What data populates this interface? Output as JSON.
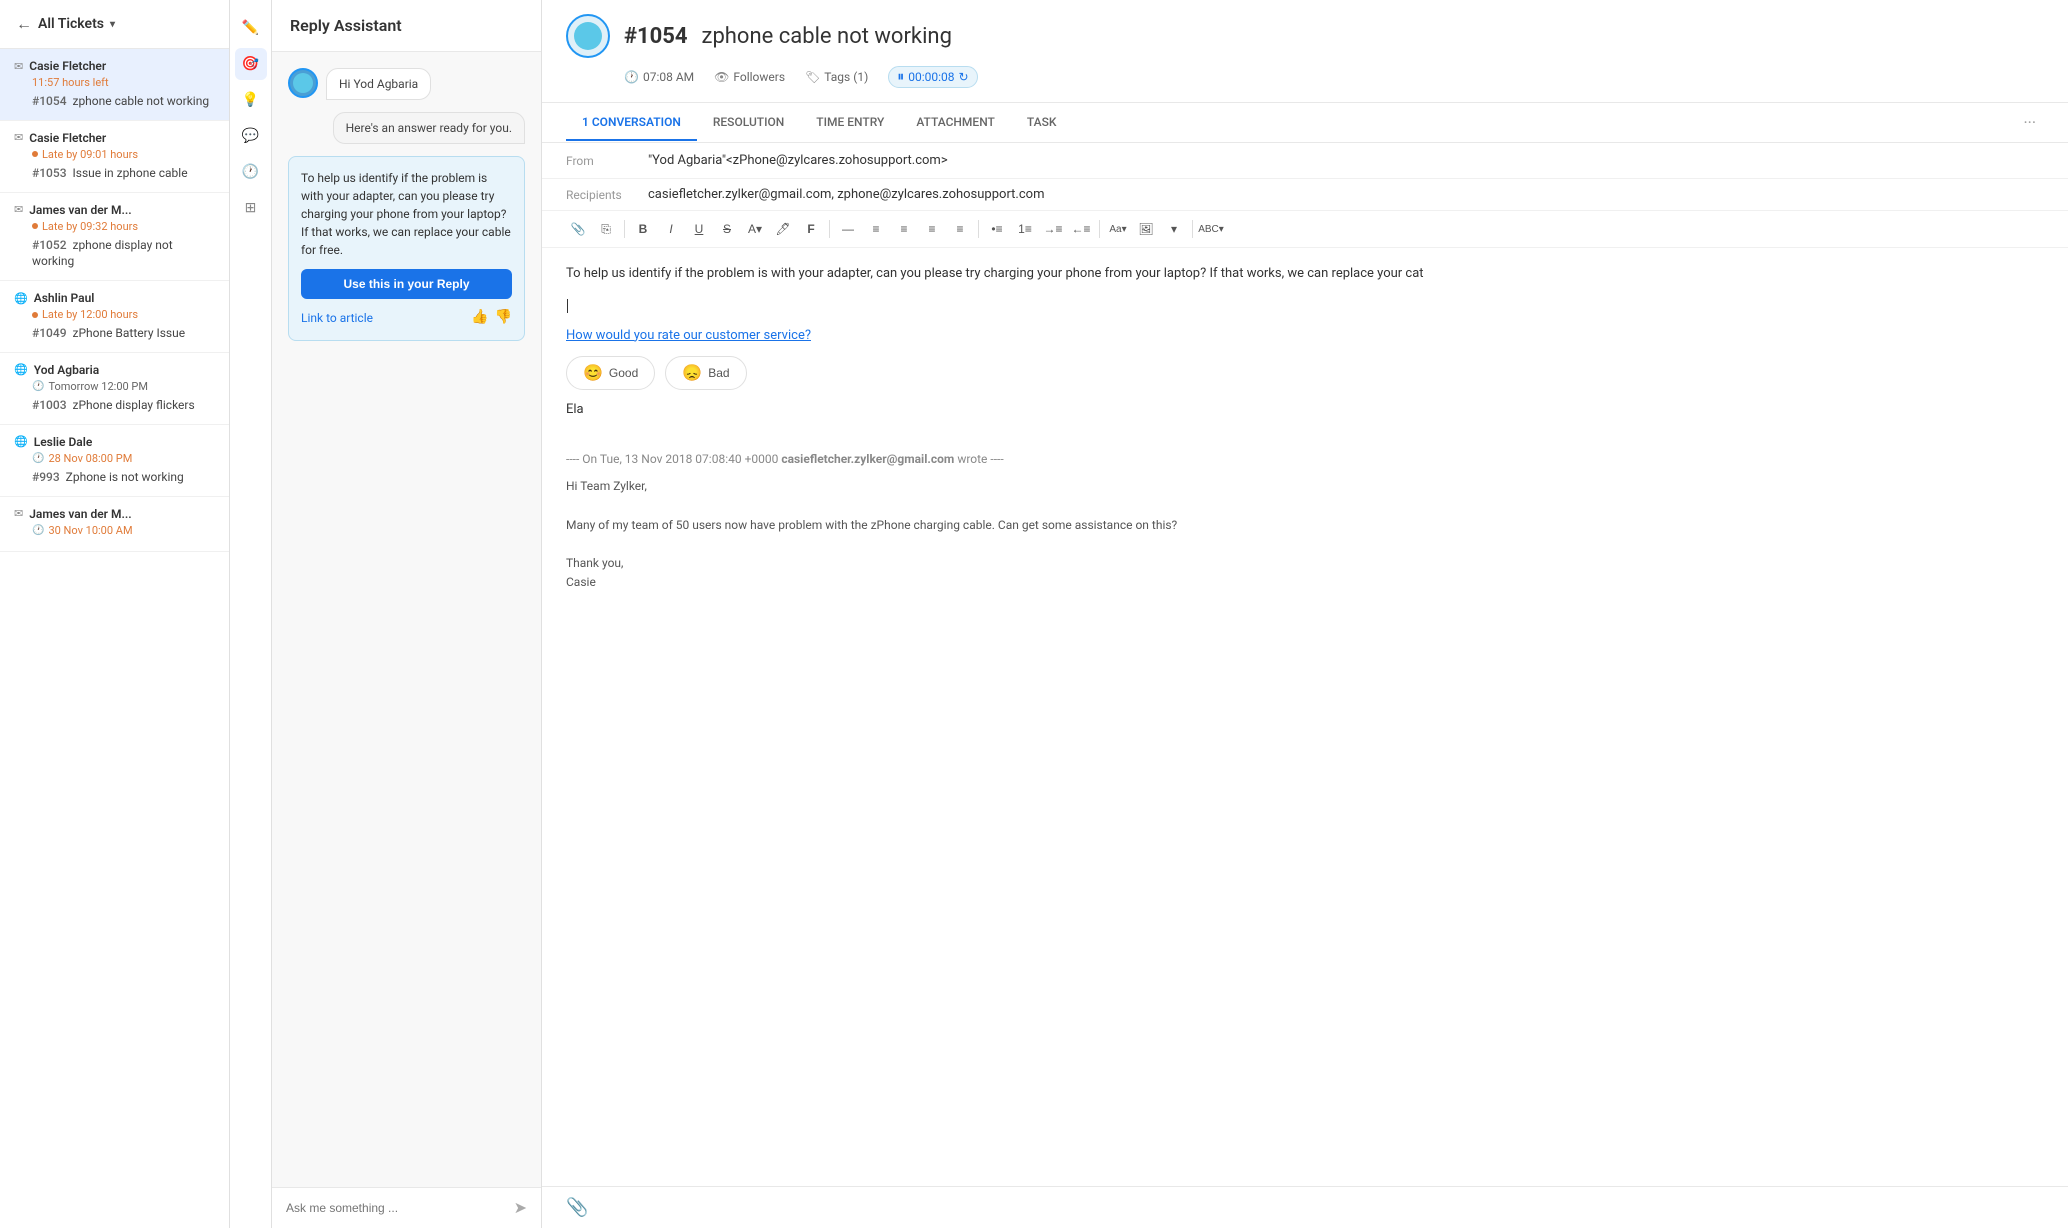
{
  "sidebar": {
    "back_label": "All Tickets",
    "tickets": [
      {
        "id": "ticket-1",
        "contact_name": "Casie Fletcher",
        "contact_type": "email",
        "time": "11:57 hours left",
        "time_type": "warning",
        "ticket_number": "#1054",
        "ticket_subject": "zphone cable not working",
        "active": true
      },
      {
        "id": "ticket-2",
        "contact_name": "Casie Fletcher",
        "contact_type": "email",
        "time": "Late by 09:01 hours",
        "time_type": "late",
        "ticket_number": "#1053",
        "ticket_subject": "Issue in zphone cable",
        "active": false
      },
      {
        "id": "ticket-3",
        "contact_name": "James van der M...",
        "contact_type": "email",
        "time": "Late by 09:32 hours",
        "time_type": "late",
        "ticket_number": "#1052",
        "ticket_subject": "zphone display not working",
        "active": false
      },
      {
        "id": "ticket-4",
        "contact_name": "Ashlin Paul",
        "contact_type": "globe",
        "time": "Late by 12:00 hours",
        "time_type": "late",
        "ticket_number": "#1049",
        "ticket_subject": "zPhone Battery Issue",
        "active": false
      },
      {
        "id": "ticket-5",
        "contact_name": "Yod Agbaria",
        "contact_type": "globe",
        "time": "Tomorrow 12:00 PM",
        "time_type": "tomorrow",
        "ticket_number": "#1003",
        "ticket_subject": "zPhone display flickers",
        "active": false
      },
      {
        "id": "ticket-6",
        "contact_name": "Leslie Dale",
        "contact_type": "globe",
        "time": "28 Nov 08:00 PM",
        "time_type": "normal",
        "ticket_number": "#993",
        "ticket_subject": "Zphone is not working",
        "active": false
      },
      {
        "id": "ticket-7",
        "contact_name": "James van der M...",
        "contact_type": "email",
        "time": "30 Nov 10:00 AM",
        "time_type": "normal",
        "ticket_number": "",
        "ticket_subject": "",
        "active": false
      }
    ]
  },
  "toolbar": {
    "icons": [
      "edit-icon",
      "target-icon",
      "bulb-icon",
      "chat-icon",
      "history-icon",
      "layers-icon"
    ]
  },
  "assistant": {
    "title": "Reply Assistant",
    "greeting": "Hi Yod Agbaria",
    "intro": "Here's an answer ready for you.",
    "suggestion": "To help us identify if the problem is with your adapter, can you please try charging your phone from your laptop? If that works, we can replace your cable for free.",
    "use_reply_label": "Use this in your Reply",
    "link_article_label": "Link to article",
    "input_placeholder": "Ask me something ...",
    "thumbs_up": "👍",
    "thumbs_down": "👎"
  },
  "ticket": {
    "number": "#1054",
    "subject": "zphone cable not working",
    "meta": {
      "time": "07:08 AM",
      "followers_label": "Followers",
      "tags_label": "Tags (1)",
      "timer": "00:00:08"
    },
    "tabs": [
      {
        "label": "1 CONVERSATION",
        "active": true,
        "badge": ""
      },
      {
        "label": "RESOLUTION",
        "active": false
      },
      {
        "label": "TIME ENTRY",
        "active": false
      },
      {
        "label": "ATTACHMENT",
        "active": false
      },
      {
        "label": "TASK",
        "active": false
      }
    ],
    "from_label": "From",
    "from_value": "\"Yod Agbaria\"<zPhone@zylcares.zohosupport.com>",
    "recipients_label": "Recipients",
    "recipients_value": "casiefletcher.zylker@gmail.com, zphone@zylcares.zohosupport.com",
    "reply_text": "To help us identify if the problem is with your adapter, can you please try charging your phone from your laptop? If that works, we can replace your cat",
    "csat_link": "How would you rate our customer service?",
    "csat_good": "Good",
    "csat_bad": "Bad",
    "signature": "Ela",
    "quoted_header": "---- On Tue, 13 Nov 2018 07:08:40 +0000",
    "quoted_sender": "casiefletcher.zylker@gmail.com",
    "quoted_wrote": "wrote ----",
    "quoted_body_1": "Hi Team Zylker,",
    "quoted_body_2": "Many of my team of 50 users now have problem with the zPhone charging cable. Can get some assistance on this?",
    "quoted_body_3": "Thank you,",
    "quoted_body_4": "Casie"
  },
  "colors": {
    "primary_blue": "#1a73e8",
    "late_orange": "#e07b39",
    "active_bg": "#e8f0fe",
    "border": "#e0e0e0"
  }
}
